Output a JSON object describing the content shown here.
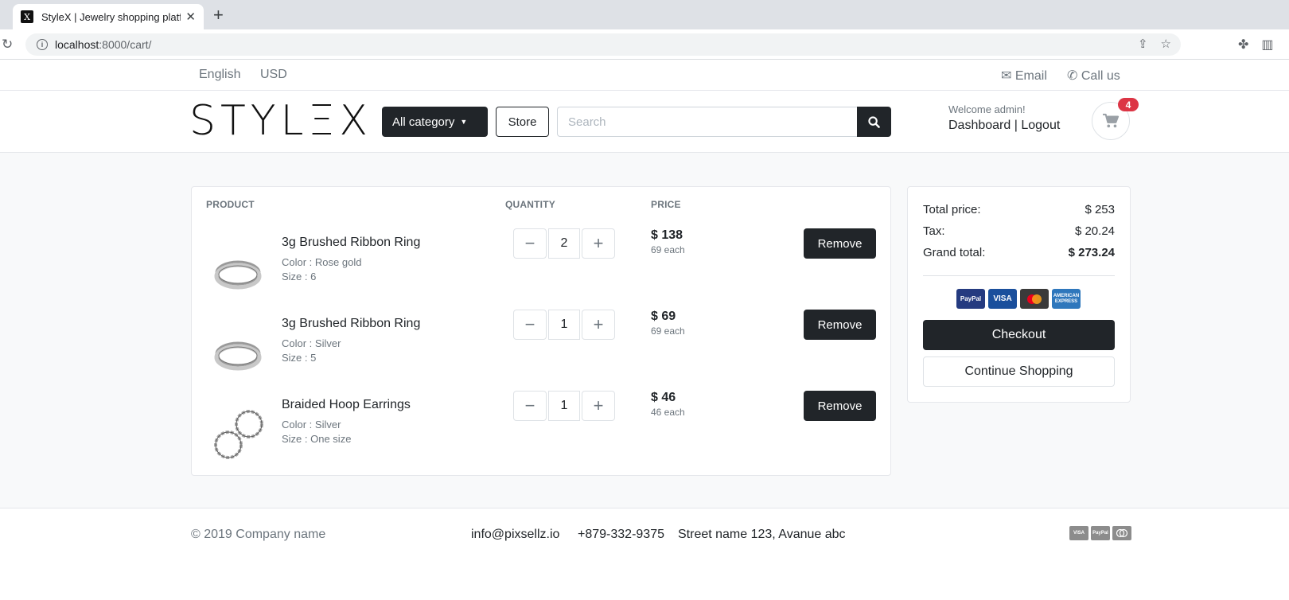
{
  "browser": {
    "tab_title": "StyleX | Jewelry shopping platform",
    "favicon_letter": "X",
    "url_host": "localhost",
    "url_path": ":8000/cart/"
  },
  "topbar": {
    "language": "English",
    "currency": "USD",
    "email_label": "Email",
    "call_label": "Call us"
  },
  "header": {
    "logo": "STYLΞX",
    "category_button": "All category",
    "store_button": "Store",
    "search_placeholder": "Search",
    "welcome": "Welcome admin!",
    "dashboard_link": "Dashboard",
    "separator": "|",
    "logout_link": "Logout",
    "cart_count": "4"
  },
  "cart": {
    "headers": {
      "product": "PRODUCT",
      "quantity": "QUANTITY",
      "price": "PRICE"
    },
    "items": [
      {
        "name": "3g Brushed Ribbon Ring",
        "color": "Color : Rose gold",
        "size": "Size : 6",
        "qty": "2",
        "price": "$ 138",
        "each": "69 each",
        "remove": "Remove",
        "thumb": "ring"
      },
      {
        "name": "3g Brushed Ribbon Ring",
        "color": "Color : Silver",
        "size": "Size : 5",
        "qty": "1",
        "price": "$ 69",
        "each": "69 each",
        "remove": "Remove",
        "thumb": "ring"
      },
      {
        "name": "Braided Hoop Earrings",
        "color": "Color : Silver",
        "size": "Size : One size",
        "qty": "1",
        "price": "$ 46",
        "each": "46 each",
        "remove": "Remove",
        "thumb": "earrings"
      }
    ]
  },
  "summary": {
    "total_label": "Total price:",
    "total_value": "$ 253",
    "tax_label": "Tax:",
    "tax_value": "$ 20.24",
    "grand_label": "Grand total:",
    "grand_value": "$ 273.24",
    "payment_icons": [
      "PayPal",
      "VISA",
      "mastercard",
      "AMERICAN EXPRESS"
    ],
    "checkout": "Checkout",
    "continue": "Continue Shopping"
  },
  "footer": {
    "copyright": "© 2019 Company name",
    "email": "info@pixsellz.io",
    "phone": "+879-332-9375",
    "address": "Street name 123, Avanue abc",
    "payment_icons": [
      "VISA",
      "PayPal",
      "mastercard"
    ]
  }
}
